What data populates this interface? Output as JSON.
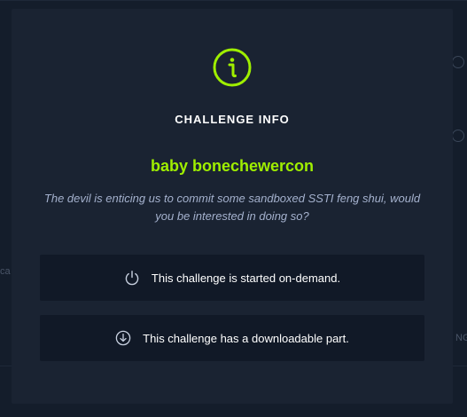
{
  "modal": {
    "title": "CHALLENGE INFO",
    "challenge_name": "baby bonechewercon",
    "description": "The devil is enticing us to commit some sandboxed SSTI feng shui, would you be interested in doing so?",
    "features": [
      {
        "icon": "power-icon",
        "text": "This challenge is started on-demand."
      },
      {
        "icon": "download-icon",
        "text": "This challenge has a downloadable part."
      }
    ]
  },
  "background": {
    "fragment_left": "ca",
    "fragment_right": "NG"
  },
  "colors": {
    "accent": "#9fef00",
    "background": "#141d2b",
    "modal": "#1a2332",
    "feature_box": "#111927",
    "muted_text": "#a4b1cd"
  }
}
